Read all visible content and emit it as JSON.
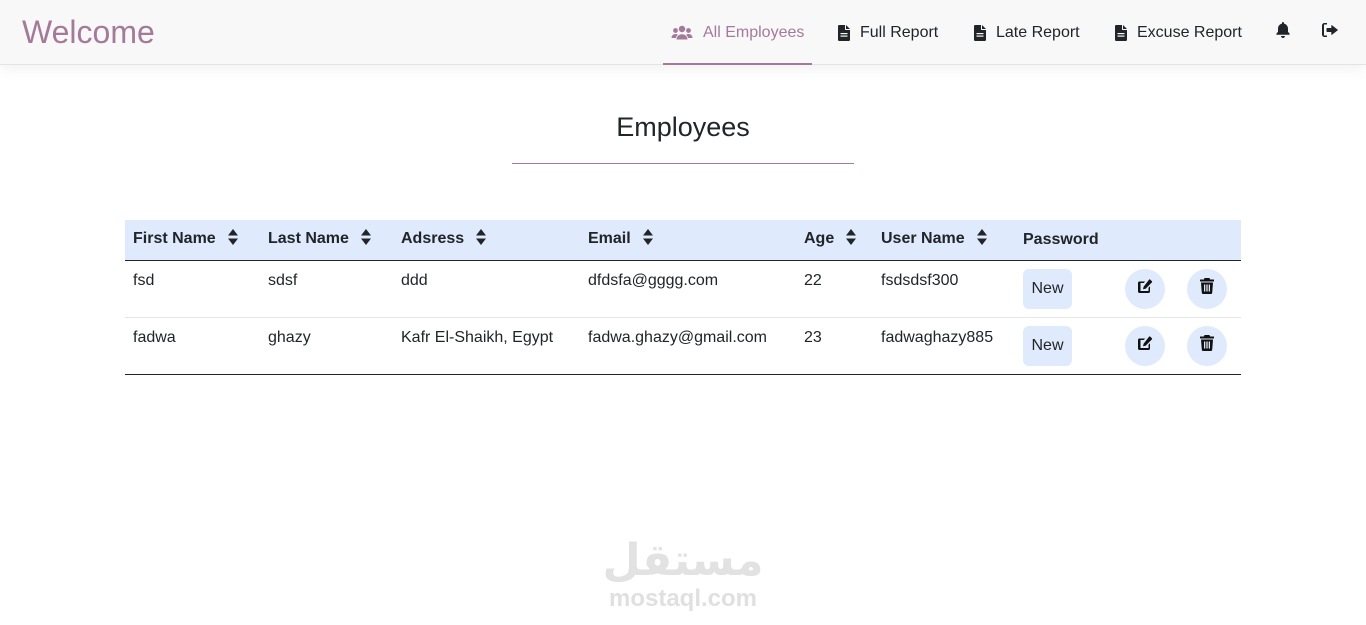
{
  "navbar": {
    "brand": "Welcome",
    "items": [
      {
        "label": "All Employees",
        "icon": "users-icon",
        "active": true
      },
      {
        "label": "Full Report",
        "icon": "file-icon",
        "active": false
      },
      {
        "label": "Late Report",
        "icon": "file-icon",
        "active": false
      },
      {
        "label": "Excuse Report",
        "icon": "file-icon",
        "active": false
      }
    ],
    "icon_buttons": [
      "bell-icon",
      "sign-out-icon"
    ]
  },
  "page": {
    "title": "Employees"
  },
  "table": {
    "columns": [
      {
        "label": "First Name",
        "sortable": true
      },
      {
        "label": "Last Name",
        "sortable": true
      },
      {
        "label": "Adsress",
        "sortable": true
      },
      {
        "label": "Email",
        "sortable": true
      },
      {
        "label": "Age",
        "sortable": true
      },
      {
        "label": "User Name",
        "sortable": true
      },
      {
        "label": "Password",
        "sortable": false
      }
    ],
    "rows": [
      {
        "first_name": "fsd",
        "last_name": "sdsf",
        "address": "ddd",
        "email": "dfdsfa@gggg.com",
        "age": "22",
        "user_name": "fsdsdsf300",
        "password_button": "New"
      },
      {
        "first_name": "fadwa",
        "last_name": "ghazy",
        "address": "Kafr El-Shaikh, Egypt",
        "email": "fadwa.ghazy@gmail.com",
        "age": "23",
        "user_name": "fadwaghazy885",
        "password_button": "New"
      }
    ],
    "row_actions": [
      "edit-icon",
      "trash-icon"
    ]
  },
  "watermark": {
    "arabic": "مستقل",
    "latin": "mostaql.com"
  },
  "colors": {
    "accent": "#a47a9a",
    "header_bg": "#dfeafc",
    "navbar_bg": "#f8f8f8"
  }
}
